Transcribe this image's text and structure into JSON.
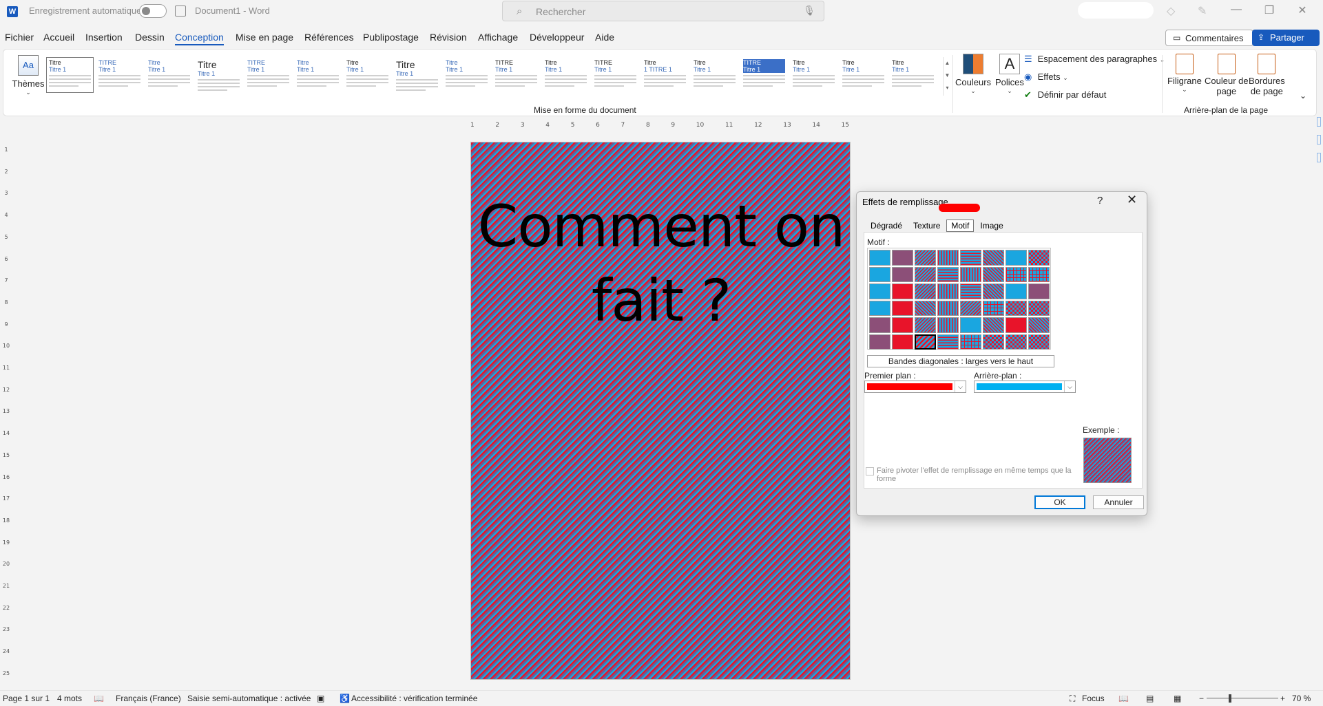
{
  "titlebar": {
    "app_logo": "W",
    "autosave_label": "Enregistrement automatique",
    "doc_title": "Document1  -  Word",
    "search_placeholder": "Rechercher"
  },
  "menu": {
    "items": [
      "Fichier",
      "Accueil",
      "Insertion",
      "Dessin",
      "Conception",
      "Mise en page",
      "Références",
      "Publipostage",
      "Révision",
      "Affichage",
      "Développeur",
      "Aide"
    ],
    "active": "Conception",
    "comments_label": "Commentaires",
    "share_label": "Partager"
  },
  "ribbon": {
    "themes_label": "Thèmes",
    "themes_icon_text": "Aa",
    "styles": [
      {
        "title": "Titre",
        "sub": "Titre 1"
      },
      {
        "title": "TITRE",
        "sub": "Titre 1"
      },
      {
        "title": "Titre",
        "sub": "Titre 1"
      },
      {
        "title": "Titre",
        "sub": "Titre 1"
      },
      {
        "title": "TITRE",
        "sub": "Titre 1"
      },
      {
        "title": "Titre",
        "sub": "Titre 1"
      },
      {
        "title": "Titre",
        "sub": "Titre 1"
      },
      {
        "title": "Titre",
        "sub": "Titre 1"
      },
      {
        "title": "Titre",
        "sub": "Titre 1"
      },
      {
        "title": "TITRE",
        "sub": "Titre 1"
      },
      {
        "title": "Titre",
        "sub": "Titre 1"
      },
      {
        "title": "TITRE",
        "sub": "Titre 1"
      },
      {
        "title": "Titre",
        "sub": "1 TITRE 1"
      },
      {
        "title": "Titre",
        "sub": "Titre 1"
      },
      {
        "title": "TITRE",
        "sub": "Titre 1"
      },
      {
        "title": "Titre",
        "sub": "Titre 1"
      },
      {
        "title": "Titre",
        "sub": "Titre 1"
      },
      {
        "title": "Titre",
        "sub": "Titre 1"
      }
    ],
    "doc_format_group": "Mise en forme du document",
    "colors_label": "Couleurs",
    "fonts_label": "Polices",
    "fonts_icon_text": "A",
    "para_spacing_label": "Espacement des paragraphes",
    "effects_label": "Effets",
    "default_label": "Définir par défaut",
    "watermark_label": "Filigrane",
    "page_color_label_1": "Couleur de",
    "page_color_label_2": "page",
    "borders_label_1": "Bordures",
    "borders_label_2": "de page",
    "background_group": "Arrière-plan de la page"
  },
  "ruler": {
    "h_ticks": [
      "1",
      "2",
      "3",
      "4",
      "5",
      "6",
      "7",
      "8",
      "9",
      "10",
      "11",
      "12",
      "13",
      "14",
      "15"
    ],
    "v_ticks": [
      "1",
      "2",
      "3",
      "4",
      "5",
      "6",
      "7",
      "8",
      "9",
      "10",
      "11",
      "12",
      "13",
      "14",
      "15",
      "16",
      "17",
      "18",
      "19",
      "20",
      "21",
      "22",
      "23",
      "24",
      "25"
    ]
  },
  "document": {
    "line1": "Comment on",
    "line2": "fait ?",
    "background_colors": {
      "foreground": "#e8142a",
      "background": "#1aa6e0"
    }
  },
  "dialog": {
    "title": "Effets de remplissage",
    "help": "?",
    "tabs": [
      "Dégradé",
      "Texture",
      "Motif",
      "Image"
    ],
    "active_tab": "Motif",
    "motif_label": "Motif :",
    "selected_pattern_name": "Bandes diagonales : larges vers le haut",
    "foreground_label": "Premier plan :",
    "background_label": "Arrière-plan :",
    "foreground_color": "#ff0000",
    "background_color": "#00b0f0",
    "rotate_label": "Faire pivoter l'effet de remplissage en même temps que la forme",
    "example_label": "Exemple :",
    "ok_label": "OK",
    "cancel_label": "Annuler"
  },
  "status": {
    "page": "Page 1 sur 1",
    "words": "4 mots",
    "language": "Français (France)",
    "autocomplete": "Saisie semi-automatique : activée",
    "accessibility": "Accessibilité : vérification terminée",
    "focus": "Focus",
    "zoom_minus": "−",
    "zoom_plus": "+",
    "zoom": "70 %"
  }
}
